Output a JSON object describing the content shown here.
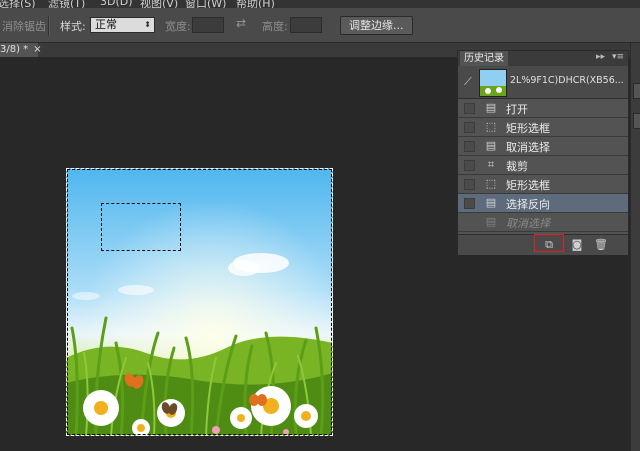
{
  "menu": {
    "items": [
      "选择(S)",
      "滤镜(T)",
      "3D(D)",
      "视图(V)",
      "窗口(W)",
      "帮助(H)"
    ]
  },
  "options": {
    "antialias_label": "消除锯齿",
    "style_label": "样式:",
    "style_value": "正常",
    "width_label": "宽度:",
    "height_label": "高度:",
    "refine_button": "调整边缘..."
  },
  "tab": {
    "label": "3/8) *",
    "close": "×"
  },
  "history": {
    "title": "历史记录",
    "snapshot_name": "2L%9F1C)DHCR(XB56...",
    "items": [
      {
        "label": "打开",
        "icon": "document-icon"
      },
      {
        "label": "矩形选框",
        "icon": "marquee-icon"
      },
      {
        "label": "取消选择",
        "icon": "document-icon"
      },
      {
        "label": "裁剪",
        "icon": "crop-icon"
      },
      {
        "label": "矩形选框",
        "icon": "marquee-icon"
      },
      {
        "label": "选择反向",
        "icon": "document-icon"
      },
      {
        "label": "取消选择",
        "icon": "document-icon"
      }
    ],
    "selected_index": 5,
    "controls": {
      "collapse": "▸▸",
      "menu": "▾≡"
    }
  },
  "colors": {
    "ui_background": "#282828",
    "panel": "#535353",
    "selected_row": "#5d6b7d",
    "highlight_box": "#e02020"
  }
}
